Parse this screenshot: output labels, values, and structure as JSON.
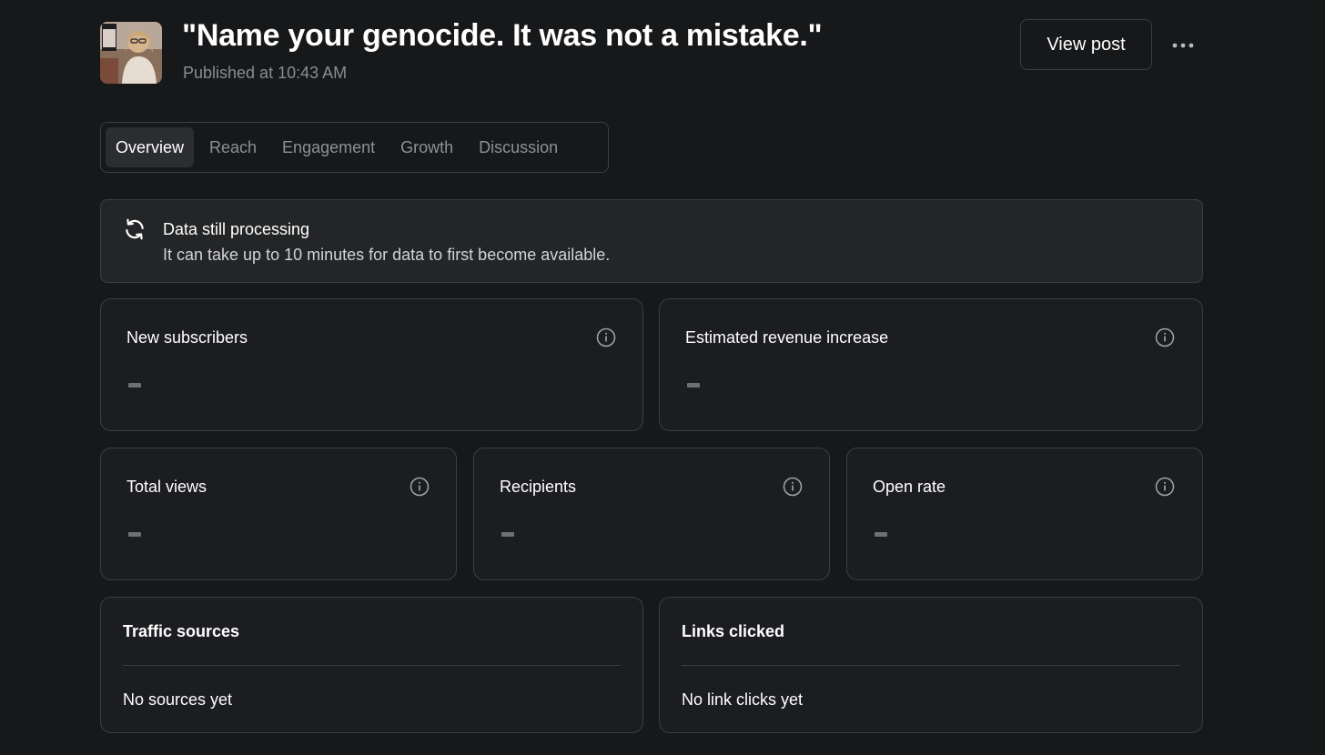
{
  "post": {
    "title": "\"Name your genocide. It was not a mistake.\"",
    "published": "Published at 10:43 AM",
    "view_post_label": "View post",
    "more_icon": "more-horizontal-icon"
  },
  "tabs": [
    {
      "label": "Overview",
      "active": true
    },
    {
      "label": "Reach",
      "active": false
    },
    {
      "label": "Engagement",
      "active": false
    },
    {
      "label": "Growth",
      "active": false
    },
    {
      "label": "Discussion",
      "active": false
    }
  ],
  "notice": {
    "icon": "refresh-icon",
    "title": "Data still processing",
    "text": "It can take up to 10 minutes for data to first become available."
  },
  "metrics": {
    "new_subscribers": {
      "label": "New subscribers",
      "value": "–"
    },
    "estimated_revenue": {
      "label": "Estimated revenue increase",
      "value": "–"
    },
    "total_views": {
      "label": "Total views",
      "value": "–"
    },
    "recipients": {
      "label": "Recipients",
      "value": "–"
    },
    "open_rate": {
      "label": "Open rate",
      "value": "–"
    }
  },
  "traffic_sources": {
    "title": "Traffic sources",
    "empty": "No sources yet"
  },
  "links_clicked": {
    "title": "Links clicked",
    "empty": "No link clicks yet"
  },
  "colors": {
    "background": "#17181a",
    "card": "#1c1d20",
    "border": "#3c3e42",
    "muted_text": "#8a8c90",
    "active_tab_bg": "#2c2d30"
  }
}
